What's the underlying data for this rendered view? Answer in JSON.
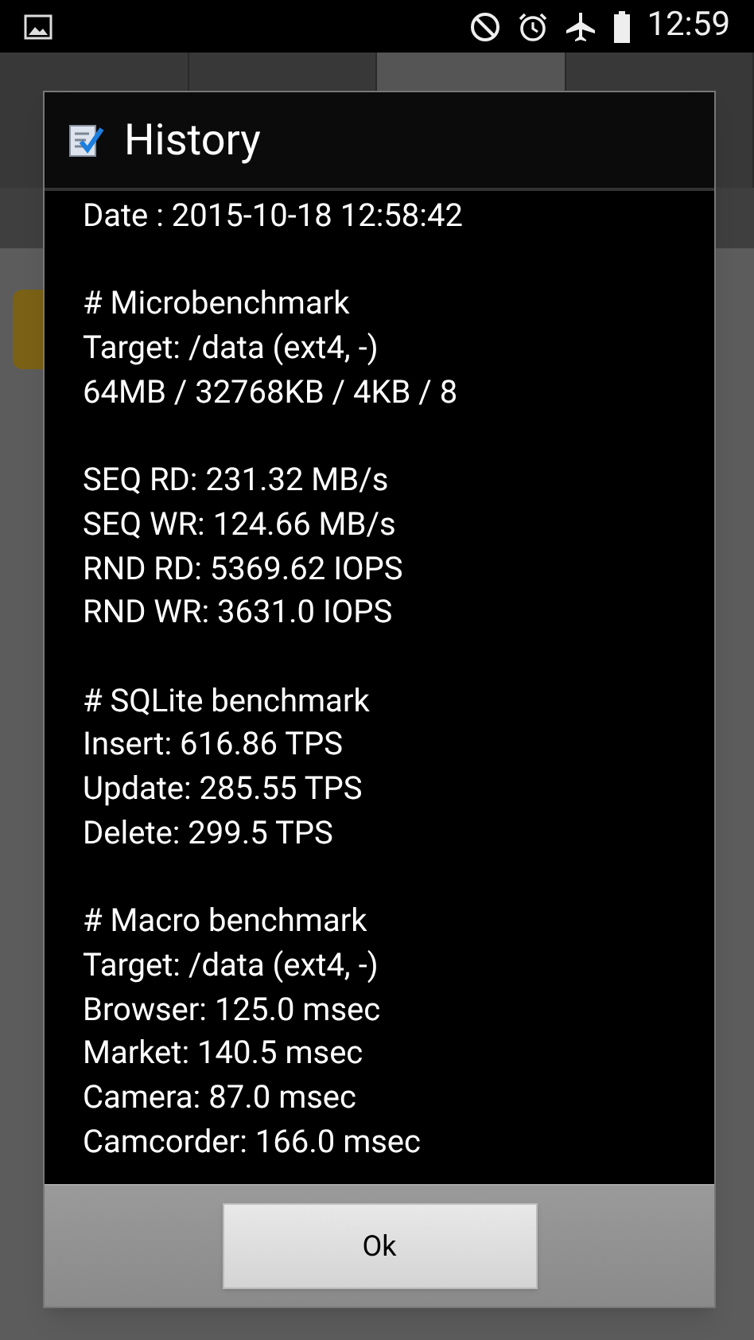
{
  "status_bar": {
    "time": "12:59"
  },
  "tabs": [
    {
      "selected": false
    },
    {
      "selected": false
    },
    {
      "selected": true
    },
    {
      "selected": false
    }
  ],
  "dialog": {
    "title": "History",
    "sections": [
      {
        "lines": [
          "Date : 2015-10-18 12:58:42"
        ]
      },
      {
        "lines": [
          "# Microbenchmark",
          "Target: /data (ext4, -)",
          "64MB / 32768KB / 4KB / 8"
        ]
      },
      {
        "lines": [
          "SEQ RD: 231.32 MB/s",
          "SEQ WR: 124.66 MB/s",
          "RND RD: 5369.62 IOPS",
          "RND WR: 3631.0 IOPS"
        ]
      },
      {
        "lines": [
          "# SQLite benchmark",
          "Insert: 616.86 TPS",
          "Update: 285.55 TPS",
          "Delete: 299.5 TPS"
        ]
      },
      {
        "lines": [
          "# Macro benchmark",
          "Target: /data (ext4, -)",
          "Browser: 125.0 msec",
          "Market: 140.5 msec",
          "Camera: 87.0 msec",
          "Camcorder: 166.0 msec"
        ]
      }
    ],
    "buttons": [
      "Ok"
    ]
  }
}
